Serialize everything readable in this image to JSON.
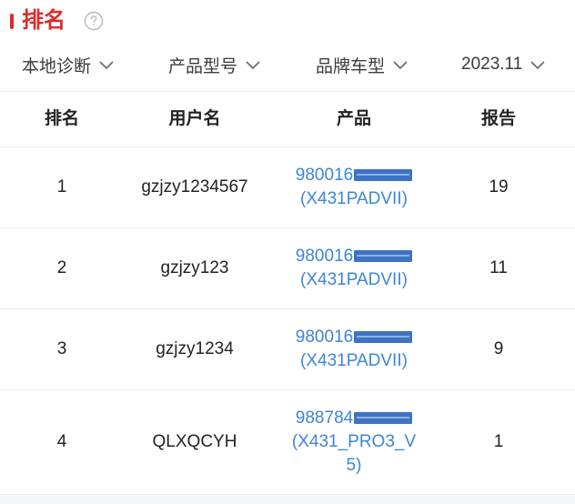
{
  "header": {
    "title": "排名"
  },
  "filters": [
    {
      "label": "本地诊断"
    },
    {
      "label": "产品型号"
    },
    {
      "label": "品牌车型"
    },
    {
      "label": "2023.11"
    }
  ],
  "table": {
    "columns": [
      "排名",
      "用户名",
      "产品",
      "报告"
    ],
    "rows": [
      {
        "rank": "1",
        "user": "gzjzy1234567",
        "product_sn": "980016",
        "product_model": "(X431PADVII)",
        "product_model_2": "",
        "reports": "19"
      },
      {
        "rank": "2",
        "user": "gzjzy123",
        "product_sn": "980016",
        "product_model": "(X431PADVII)",
        "product_model_2": "",
        "reports": "11"
      },
      {
        "rank": "3",
        "user": "gzjzy1234",
        "product_sn": "980016",
        "product_model": "(X431PADVII)",
        "product_model_2": "",
        "reports": "9"
      },
      {
        "rank": "4",
        "user": "QLXQCYH",
        "product_sn": "988784",
        "product_model": "(X431_PRO3_V",
        "product_model_2": "5)",
        "reports": "1"
      }
    ]
  },
  "colors": {
    "accent": "#e02a2a",
    "link": "#3d86d6",
    "redaction": "#3e73c4"
  }
}
